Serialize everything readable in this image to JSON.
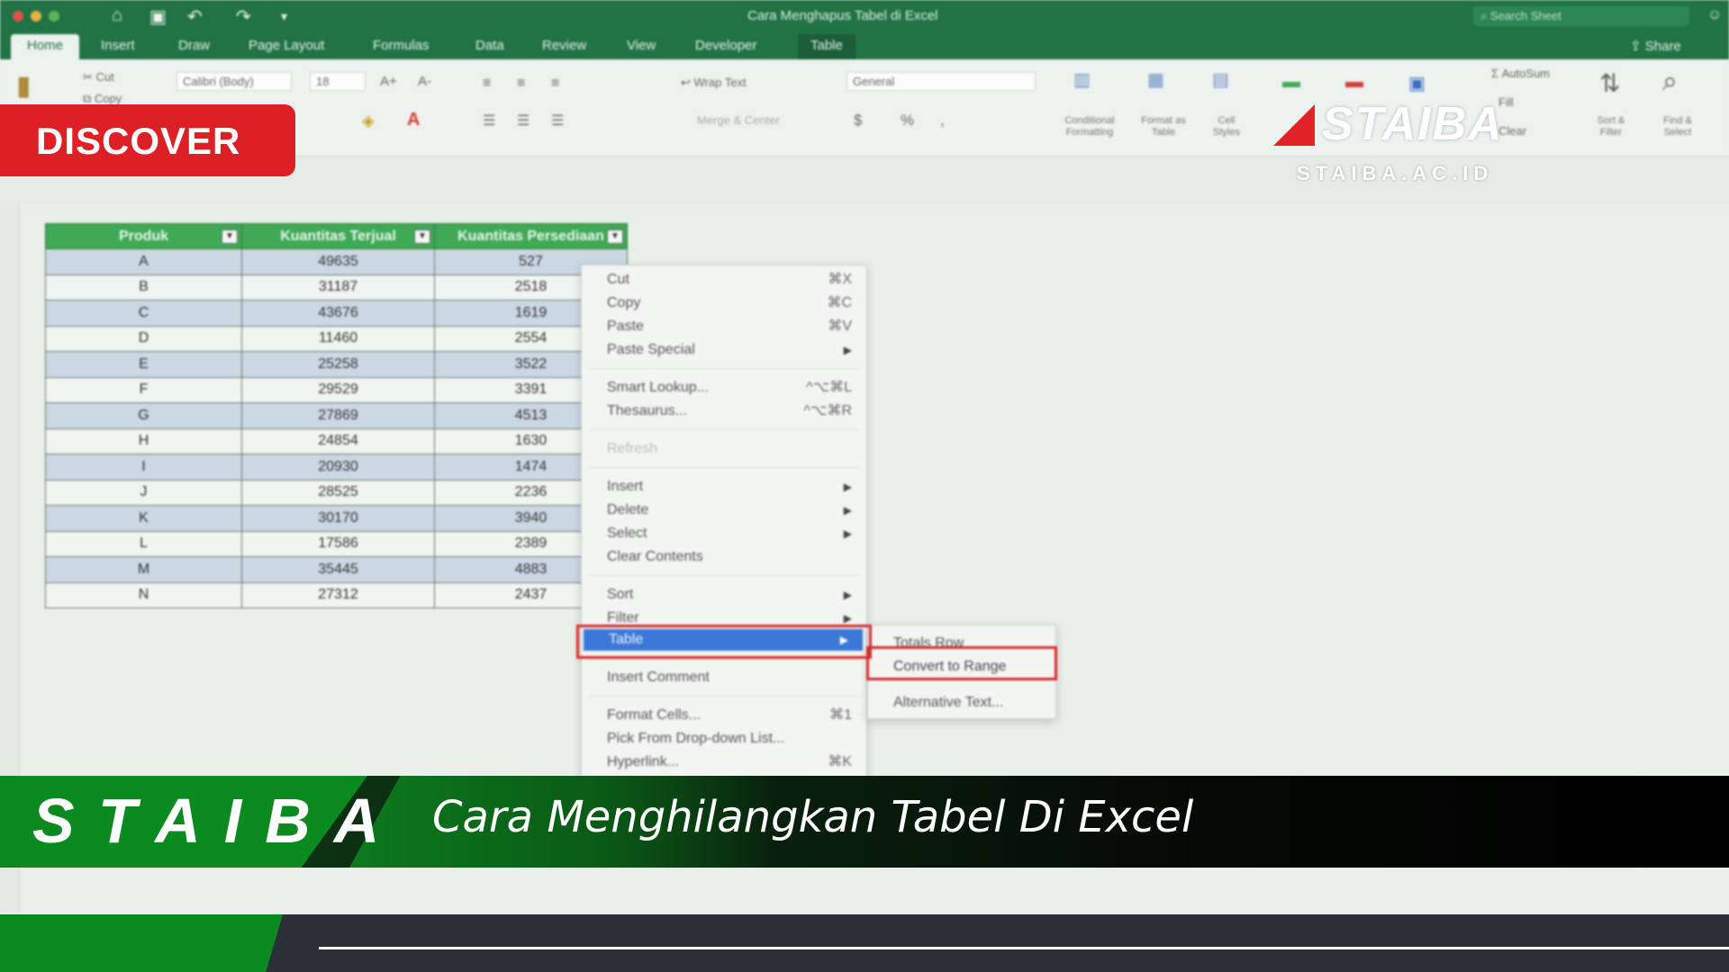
{
  "window": {
    "title": "Cara Menghapus Tabel di Excel",
    "search_placeholder": "Search Sheet"
  },
  "ribbon_tabs": [
    "Home",
    "Insert",
    "Draw",
    "Page Layout",
    "Formulas",
    "Data",
    "Review",
    "View",
    "Developer",
    "Table"
  ],
  "share_label": "Share",
  "ribbon": {
    "font_name": "Calibri (Body)",
    "font_size": "18",
    "wrap_text": "Wrap Text",
    "merge_center": "Merge & Center",
    "number_format": "General",
    "conditional_formatting": "Conditional Formatting",
    "format_as_table": "Format as Table",
    "cell_styles": "Cell Styles",
    "autosum": "AutoSum",
    "fill": "Fill",
    "clear": "Clear",
    "sort_filter": "Sort & Filter",
    "find_select": "Find & Select",
    "cut": "Cut",
    "copy": "Copy"
  },
  "table": {
    "headers": [
      "Produk",
      "Kuantitas Terjual",
      "Kuantitas Persediaan"
    ],
    "rows": [
      [
        "A",
        "49635",
        "527"
      ],
      [
        "B",
        "31187",
        "2518"
      ],
      [
        "C",
        "43676",
        "1619"
      ],
      [
        "D",
        "11460",
        "2554"
      ],
      [
        "E",
        "25258",
        "3522"
      ],
      [
        "F",
        "29529",
        "3391"
      ],
      [
        "G",
        "27869",
        "4513"
      ],
      [
        "H",
        "24854",
        "1630"
      ],
      [
        "I",
        "20930",
        "1474"
      ],
      [
        "J",
        "28525",
        "2236"
      ],
      [
        "K",
        "30170",
        "3940"
      ],
      [
        "L",
        "17586",
        "2389"
      ],
      [
        "M",
        "35445",
        "4883"
      ],
      [
        "N",
        "27312",
        "2437"
      ]
    ]
  },
  "context_menu": {
    "cut": "Cut",
    "cut_sc": "⌘X",
    "copy": "Copy",
    "copy_sc": "⌘C",
    "paste": "Paste",
    "paste_sc": "⌘V",
    "paste_special": "Paste Special",
    "smart_lookup": "Smart Lookup...",
    "smart_lookup_sc": "^⌥⌘L",
    "thesaurus": "Thesaurus...",
    "thesaurus_sc": "^⌥⌘R",
    "refresh": "Refresh",
    "insert": "Insert",
    "delete": "Delete",
    "select": "Select",
    "clear_contents": "Clear Contents",
    "sort": "Sort",
    "filter": "Filter",
    "table": "Table",
    "insert_comment": "Insert Comment",
    "format_cells": "Format Cells...",
    "format_cells_sc": "⌘1",
    "pick_dropdown": "Pick From Drop-down List...",
    "hyperlink": "Hyperlink...",
    "hyperlink_sc": "⌘K"
  },
  "submenu": {
    "totals_row": "Totals Row",
    "convert_to_range": "Convert to Range",
    "alternative_text": "Alternative Text..."
  },
  "overlay": {
    "discover": "DISCOVER",
    "logo_word": "STAIBA",
    "logo_url": "STAIBA.AC.ID",
    "banner_brand": "STAIBA",
    "banner_title": "Cara Menghilangkan Tabel Di Excel"
  },
  "colors": {
    "excel_green": "#217346",
    "discover_red": "#dd1f26",
    "highlight_blue": "#3b79d8",
    "callout_red": "#d92b2b",
    "banner_green": "#0a8a1f"
  }
}
